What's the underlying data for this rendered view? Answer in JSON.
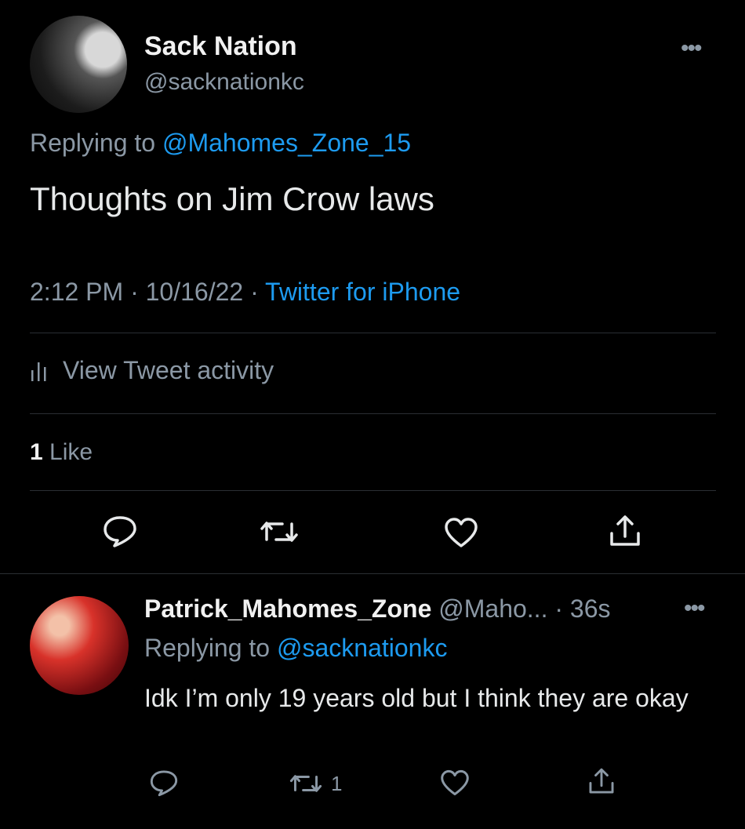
{
  "tweet": {
    "avatar": "sack-nation-avatar",
    "name": "Sack Nation",
    "handle": "@sacknationkc",
    "replying_prefix": "Replying to",
    "replying_to": "@Mahomes_Zone_15",
    "text": "Thoughts on Jim Crow laws",
    "time": "2:12 PM",
    "sep1": "·",
    "date": "10/16/22",
    "sep2": "·",
    "source": "Twitter for iPhone",
    "activity_label": "View Tweet activity",
    "like_count": "1",
    "like_label": "Like"
  },
  "reply": {
    "avatar": "patrick-mahomes-zone-avatar",
    "name": "Patrick_Mahomes_Zone",
    "handle_time": "@Maho... · 36s",
    "replying_prefix": "Replying to",
    "replying_to": "@sacknationkc",
    "text": "Idk I’m only 19 years old but I think they are okay",
    "retweet_count": "1"
  },
  "icons": [
    "more-icon",
    "reply-icon",
    "retweet-icon",
    "like-icon",
    "share-icon",
    "activity-icon"
  ],
  "colors": {
    "link": "#1d9bf0",
    "secondary": "#8b98a5",
    "text": "#e7e9ea",
    "background": "#000000"
  }
}
